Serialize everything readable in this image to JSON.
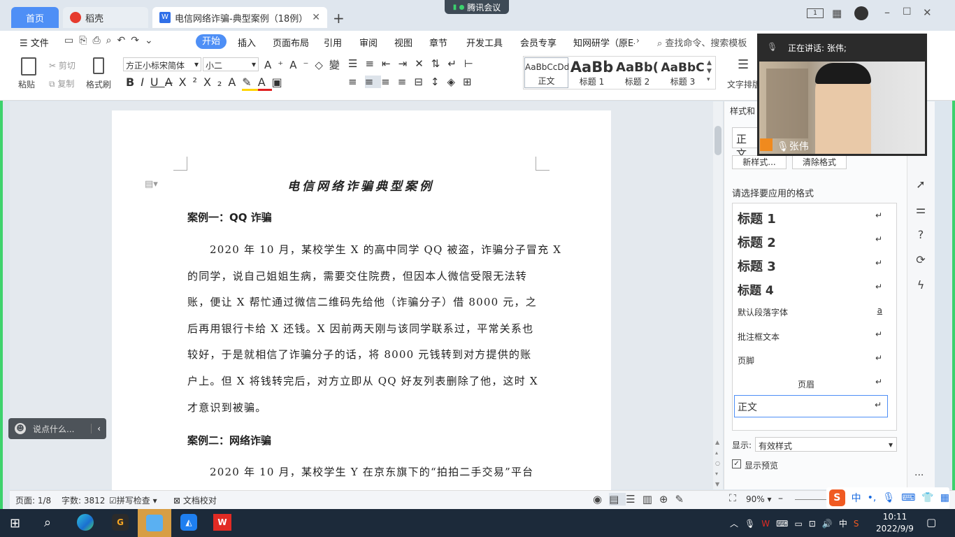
{
  "tabs": {
    "home": "首页",
    "daoke": "稻壳",
    "doc": "电信网络诈骗-典型案例（18例）",
    "meeting": "腾讯会议"
  },
  "menu": {
    "file": "文件",
    "items": [
      "开始",
      "插入",
      "页面布局",
      "引用",
      "审阅",
      "视图",
      "章节",
      "开发工具",
      "会员专享",
      "知网研学（原E-S"
    ],
    "search": "查找命令、搜索模板"
  },
  "toolbar": {
    "paste": "粘贴",
    "cut": "剪切",
    "copy": "复制",
    "format_painter": "格式刷",
    "font_name": "方正小标宋简体",
    "font_size": "小二",
    "styles": [
      {
        "preview": "AaBbCcDd",
        "label": "正文"
      },
      {
        "preview": "AaBb",
        "label": "标题 1"
      },
      {
        "preview": "AaBb(",
        "label": "标题 2"
      },
      {
        "preview": "AaBbC",
        "label": "标题 3"
      }
    ],
    "text_layout": "文字排版"
  },
  "document": {
    "title": "电信网络诈骗典型案例",
    "case1_heading": "案例一：QQ 诈骗",
    "case1_lines": [
      "2020 年 10 月，某校学生 X 的高中同学 QQ 被盗，诈骗分子冒充 X",
      "的同学，说自己姐姐生病，需要交住院费，但因本人微信受限无法转",
      "账，便让 X 帮忙通过微信二维码先给他（诈骗分子）借 8000 元，之",
      "后再用银行卡给 X 还钱。X 因前两天刚与该同学联系过，平常关系也",
      "较好，于是就相信了诈骗分子的话，将 8000 元钱转到对方提供的账",
      "户上。但 X 将钱转完后，对方立即从 QQ 好友列表删除了他，这时 X",
      "才意识到被骗。"
    ],
    "case2_heading": "案例二：网络诈骗",
    "case2_line1": "2020 年 10 月，某校学生 Y 在京东旗下的“拍拍二手交易”平台"
  },
  "chat": {
    "placeholder": "说点什么..."
  },
  "style_panel": {
    "title": "样式和",
    "current_style": "正文",
    "new_style": "新样式...",
    "clear_format": "清除格式",
    "prompt": "请选择要应用的格式",
    "items": [
      "标题  1",
      "标题  2",
      "标题  3",
      "标题  4",
      "默认段落字体",
      "批注框文本",
      "页脚",
      "页眉",
      "正文"
    ],
    "show_label": "显示:",
    "show_value": "有效样式",
    "preview_label": "显示预览"
  },
  "video": {
    "speaking": "正在讲话: 张伟;",
    "name": "张伟"
  },
  "status": {
    "page": "页面: 1/8",
    "words": "字数: 3812",
    "spell": "拼写检查",
    "proof": "文档校对",
    "zoom": "90%"
  },
  "taskbar": {
    "ime": "中",
    "time": "10:11",
    "date": "2022/9/9"
  },
  "colors": {
    "accent": "#4e8ff6",
    "highlight": "#ffd400",
    "font_color": "#e02020",
    "green_accent": "#3bd26d"
  }
}
